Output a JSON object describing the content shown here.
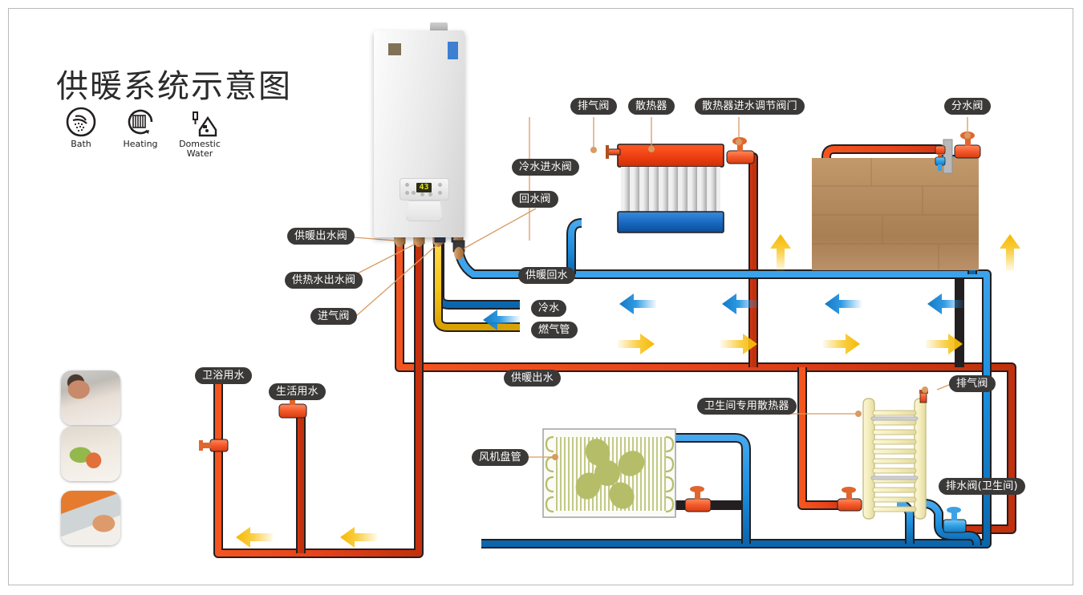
{
  "title": "供暖系统示意图",
  "legend": [
    {
      "id": "bath",
      "label": "Bath",
      "icon": "shower-icon"
    },
    {
      "id": "heating",
      "label": "Heating",
      "icon": "radiator-icon"
    },
    {
      "id": "domestic-water",
      "label": "Domestic\nWater",
      "label_line1": "Domestic",
      "label_line2": "Water",
      "icon": "house-faucet-icon"
    }
  ],
  "boiler": {
    "display_value": "43",
    "name": "wall-hung-gas-boiler"
  },
  "labels": {
    "cold_water_inlet_valve": "冷水进水阀",
    "return_water_valve": "回水阀",
    "heating_outlet_valve": "供暖出水阀",
    "hot_water_outlet_valve": "供热水出水阀",
    "gas_inlet_valve": "进气阀",
    "heating_return": "供暖回水",
    "cold_water": "冷水",
    "gas_pipe": "燃气管",
    "heating_supply": "供暖出水",
    "air_vent_radiator": "排气阀",
    "radiator": "散热器",
    "radiator_inlet_control_valve": "散热器进水调节阀门",
    "water_separator_valve": "分水阀",
    "bathroom_water": "卫浴用水",
    "domestic_water": "生活用水",
    "fan_coil_unit": "风机盘管",
    "bathroom_radiator": "卫生间专用散热器",
    "air_vent_towel": "排气阀",
    "drain_valve_bathroom": "排水阀(卫生间)"
  },
  "colors": {
    "hot_pipe": "#e8421a",
    "cold_pipe": "#1b8ede",
    "gas_pipe": "#f5c518",
    "supply_arrow": "#f9c623",
    "return_arrow": "#1b8ede",
    "pill_bg": "#3b3838",
    "leader_line": "#d89b63",
    "radiator_top": "#ee3e12",
    "radiator_bottom": "#1767c0",
    "towel_radiator": "#f7f2c4",
    "fan_coil": "#b5bd68",
    "floor_wood": "#b08a5e",
    "frame_border": "#b9b9b9"
  },
  "flow_arrows": {
    "supply_right_count": 4,
    "return_left_count": 4,
    "vertical_up_count": 2,
    "bottom_left_count": 2,
    "cold_in_count": 1
  },
  "photos": [
    {
      "id": "photo-bath",
      "alt": "woman-in-bathtub"
    },
    {
      "id": "photo-kitchen",
      "alt": "washing-vegetables"
    },
    {
      "id": "photo-handwash",
      "alt": "washing-hands-at-sink"
    }
  ]
}
